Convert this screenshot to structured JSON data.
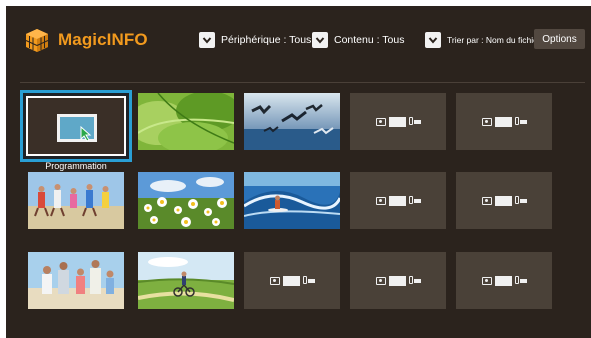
{
  "app": {
    "title": "MagicINFO"
  },
  "filters": {
    "device": "Périphérique : Tous",
    "content": "Contenu : Tous",
    "sort": "Trier par : Nom du fichier"
  },
  "options_label": "Options",
  "selected_item": {
    "label": "Programmation"
  },
  "colors": {
    "brand": "#f29a1e",
    "focus": "#2a9fd4",
    "background": "#2b231d",
    "placeholder": "#4a4138"
  },
  "icons": [
    "logo-cube-icon",
    "chevron-down-icon",
    "photo-icon",
    "video-icon",
    "music-icon",
    "schedule-icon"
  ]
}
